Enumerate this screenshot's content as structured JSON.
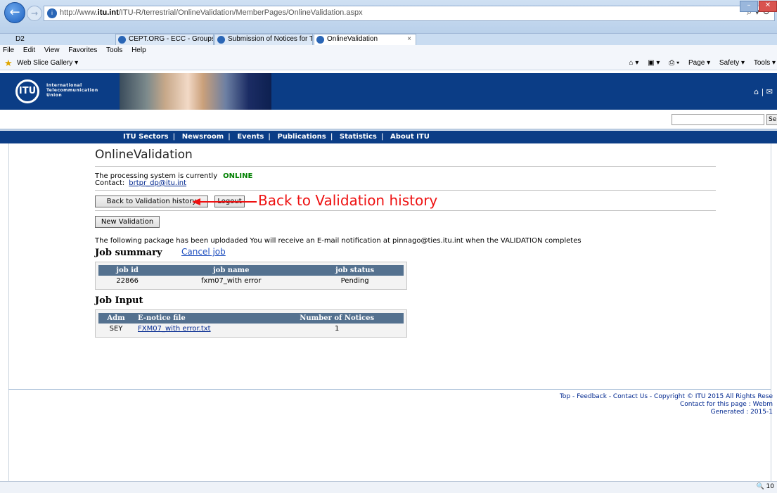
{
  "browser": {
    "url_prefix": "http://www.",
    "url_domain": "itu.int",
    "url_path": "/ITU-R/terrestrial/OnlineValidation/MemberPages/OnlineValidation.aspx",
    "tabs": [
      {
        "label": "D2"
      },
      {
        "label": "CEPT.ORG - ECC - Groups - EC..."
      },
      {
        "label": "Submission of Notices for Terr..."
      },
      {
        "label": "OnlineValidation"
      }
    ],
    "menu": [
      "File",
      "Edit",
      "View",
      "Favorites",
      "Tools",
      "Help"
    ],
    "favorites_label": "Web Slice Gallery ▾",
    "command_items": [
      "Page ▾",
      "Safety ▾",
      "Tools ▾"
    ],
    "zoom": "🔍 10"
  },
  "itu": {
    "logo_abbr": "ITU",
    "logo_line1": "International",
    "logo_line2": "Telecommunication",
    "logo_line3": "Union",
    "header_icons": "⌂ | ✉",
    "search_button": "Se",
    "nav_items": [
      "ITU Sectors",
      "Newsroom",
      "Events",
      "Publications",
      "Statistics",
      "About ITU"
    ]
  },
  "page": {
    "title": "OnlineValidation",
    "status_text": "The processing system is currently",
    "status_value": "ONLINE",
    "contact_label": "Contact:",
    "contact_link": "brtpr_dp@itu.int",
    "back_button": "Back to Validation history",
    "logout_button": "Logout",
    "annotation": "Back to Validation history",
    "new_validation_button": "New Validation",
    "upload_message": "The following package has been uplodaded You will receive an E-mail notification at pinnago@ties.itu.int when the VALIDATION completes",
    "job_summary_heading": "Job summary",
    "cancel_job_link": "Cancel job",
    "job_summary_table": {
      "headers": [
        "job id",
        "job name",
        "job status"
      ],
      "rows": [
        [
          "22866",
          "fxm07_with error",
          "Pending"
        ]
      ]
    },
    "job_input_heading": "Job Input",
    "job_input_table": {
      "headers": [
        "Adm",
        "E-notice file",
        "Number of Notices"
      ],
      "rows": [
        [
          "SEY",
          "FXM07_with error.txt",
          "1"
        ]
      ]
    }
  },
  "footer": {
    "line1": "Top - Feedback - Contact Us -  Copyright © ITU 2015 All Rights Rese",
    "line2": "Contact for this page : Webm",
    "line3": "Generated : 2015-1"
  }
}
